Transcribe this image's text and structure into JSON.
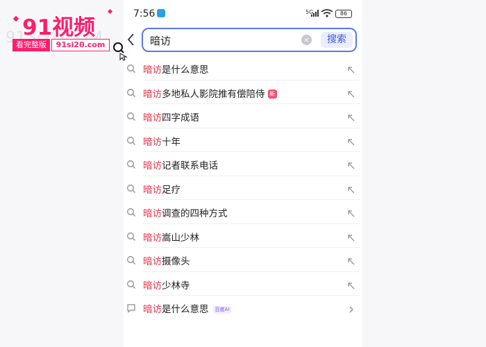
{
  "status": {
    "time": "7:56",
    "signal_label": "5G",
    "battery": "86"
  },
  "search": {
    "query": "暗访",
    "clear_glyph": "×",
    "button_label": "搜索"
  },
  "suggestions": [
    {
      "highlight": "暗访",
      "rest": "是什么意思",
      "icon": "search-icon",
      "trail": "fill-arrow-icon"
    },
    {
      "highlight": "暗访",
      "rest": "多地私人影院推有偿陪侍",
      "badge": "新",
      "icon": "search-icon",
      "trail": "fill-arrow-icon"
    },
    {
      "highlight": "暗访",
      "rest": "四字成语",
      "icon": "search-icon",
      "trail": "fill-arrow-icon"
    },
    {
      "highlight": "暗访",
      "rest": "十年",
      "icon": "search-icon",
      "trail": "fill-arrow-icon"
    },
    {
      "highlight": "暗访",
      "rest": "记者联系电话",
      "icon": "search-icon",
      "trail": "fill-arrow-icon"
    },
    {
      "highlight": "暗访",
      "rest": "足疗",
      "icon": "search-icon",
      "trail": "fill-arrow-icon"
    },
    {
      "highlight": "暗访",
      "rest": "调查的四种方式",
      "icon": "search-icon",
      "trail": "fill-arrow-icon"
    },
    {
      "highlight": "暗访",
      "rest": "嵩山少林",
      "icon": "search-icon",
      "trail": "fill-arrow-icon"
    },
    {
      "highlight": "暗访",
      "rest": "摄像头",
      "icon": "search-icon",
      "trail": "fill-arrow-icon"
    },
    {
      "highlight": "暗访",
      "rest": "少林寺",
      "icon": "search-icon",
      "trail": "fill-arrow-icon"
    },
    {
      "highlight": "暗访",
      "rest": "是什么意思",
      "ai_tag": "百度AI",
      "icon": "chat-icon",
      "trail": "chevron-right-icon"
    }
  ],
  "watermark": {
    "brand": "91视频",
    "background_text": "91SI2OCOM",
    "tag_left": "看完整版",
    "tag_right": "91si20.com"
  },
  "colors": {
    "accent": "#5b74f0",
    "highlight": "#e8344a",
    "brand": "#ff1d6b"
  }
}
